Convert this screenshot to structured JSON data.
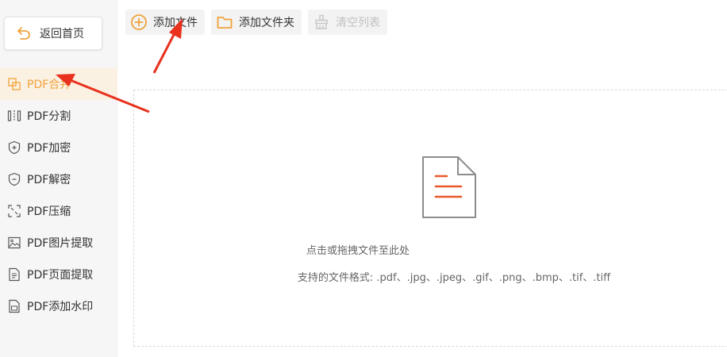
{
  "sidebar": {
    "home_label": "返回首页",
    "items": [
      {
        "label": "PDF合并",
        "icon": "merge-icon",
        "active": true
      },
      {
        "label": "PDF分割",
        "icon": "split-icon",
        "active": false
      },
      {
        "label": "PDF加密",
        "icon": "shield-plus-icon",
        "active": false
      },
      {
        "label": "PDF解密",
        "icon": "shield-minus-icon",
        "active": false
      },
      {
        "label": "PDF压缩",
        "icon": "compress-icon",
        "active": false
      },
      {
        "label": "PDF图片提取",
        "icon": "image-icon",
        "active": false
      },
      {
        "label": "PDF页面提取",
        "icon": "page-icon",
        "active": false
      },
      {
        "label": "PDF添加水印",
        "icon": "watermark-icon",
        "active": false
      }
    ]
  },
  "toolbar": {
    "add_file": "添加文件",
    "add_folder": "添加文件夹",
    "clear_list": "清空列表"
  },
  "dropzone": {
    "hint": "点击或拖拽文件至此处",
    "formats": "支持的文件格式: .pdf、.jpg、.jpeg、.gif、.png、.bmp、.tif、.tiff"
  },
  "colors": {
    "accent": "#f0a23a",
    "annotation_arrow": "#e8321e",
    "doc_lines": "#e8592b"
  }
}
